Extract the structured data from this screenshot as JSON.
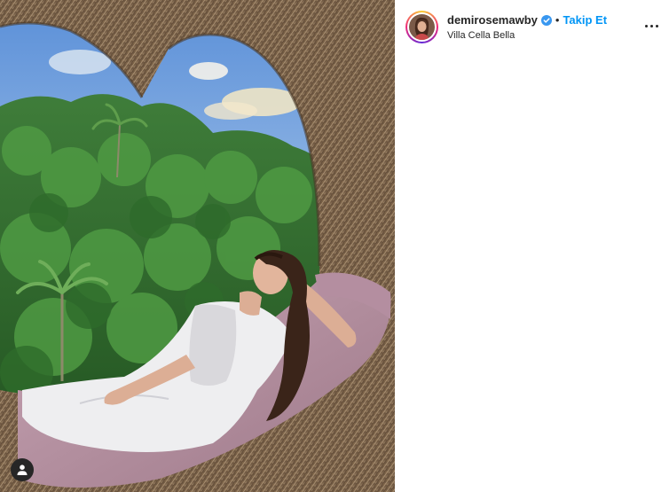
{
  "post": {
    "media": {
      "alt": "",
      "user_tag_icon": "user-tag-icon"
    },
    "header": {
      "username": "demirosemawby",
      "verified_icon": "verified-badge-icon",
      "separator": "•",
      "follow_label": "Takip Et",
      "location": "Villa Cella Bella",
      "more_icon": "more-options-icon"
    }
  },
  "colors": {
    "link_blue": "#0095f6",
    "text_primary": "#262626",
    "background": "#ffffff"
  }
}
